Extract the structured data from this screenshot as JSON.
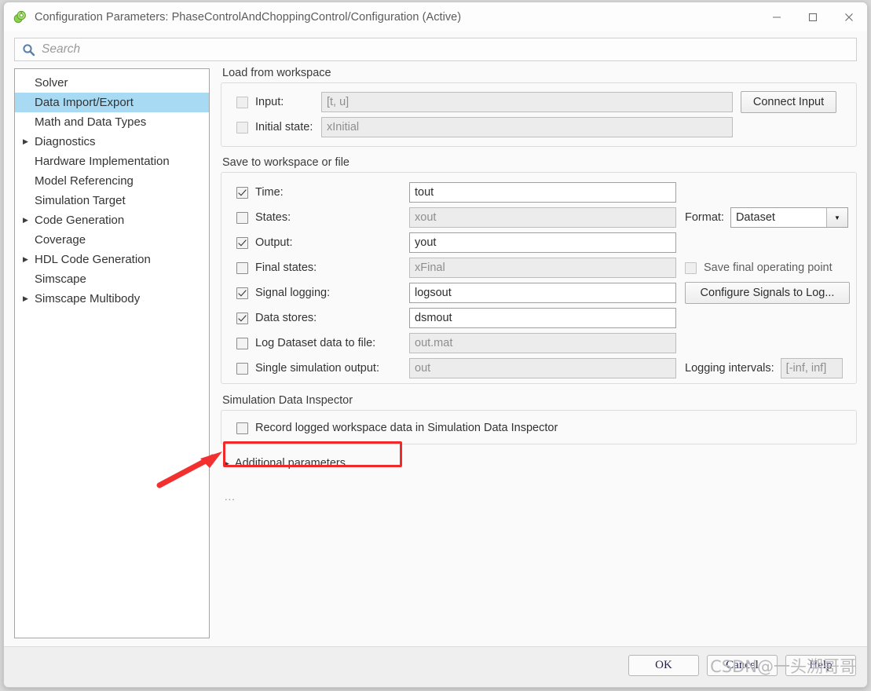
{
  "window": {
    "title": "Configuration Parameters: PhaseControlAndChoppingControl/Configuration (Active)",
    "app_icon": "simulink-config-icon",
    "minimize": "─",
    "maximize": "□",
    "close": "✕"
  },
  "search": {
    "placeholder": "Search",
    "icon": "search-icon"
  },
  "sidebar": {
    "items": [
      {
        "label": "Solver",
        "expandable": false,
        "selected": false
      },
      {
        "label": "Data Import/Export",
        "expandable": false,
        "selected": true
      },
      {
        "label": "Math and Data Types",
        "expandable": false,
        "selected": false
      },
      {
        "label": "Diagnostics",
        "expandable": true,
        "selected": false
      },
      {
        "label": "Hardware Implementation",
        "expandable": false,
        "selected": false
      },
      {
        "label": "Model Referencing",
        "expandable": false,
        "selected": false
      },
      {
        "label": "Simulation Target",
        "expandable": false,
        "selected": false
      },
      {
        "label": "Code Generation",
        "expandable": true,
        "selected": false
      },
      {
        "label": "Coverage",
        "expandable": false,
        "selected": false
      },
      {
        "label": "HDL Code Generation",
        "expandable": true,
        "selected": false
      },
      {
        "label": "Simscape",
        "expandable": false,
        "selected": false
      },
      {
        "label": "Simscape Multibody",
        "expandable": true,
        "selected": false
      }
    ],
    "expand_glyph": "▶"
  },
  "load_from_workspace": {
    "title": "Load from workspace",
    "input": {
      "label": "Input:",
      "value": "[t, u]",
      "checked": false,
      "enabled": false
    },
    "initial_state": {
      "label": "Initial state:",
      "value": "xInitial",
      "checked": false,
      "enabled": false
    },
    "connect_input_button": "Connect Input"
  },
  "save_to_workspace": {
    "title": "Save to workspace or file",
    "rows": [
      {
        "label": "Time:",
        "value": "tout",
        "checked": true,
        "enabled": true
      },
      {
        "label": "States:",
        "value": "xout",
        "checked": false,
        "enabled": false
      },
      {
        "label": "Output:",
        "value": "yout",
        "checked": true,
        "enabled": true
      },
      {
        "label": "Final states:",
        "value": "xFinal",
        "checked": false,
        "enabled": false
      },
      {
        "label": "Signal logging:",
        "value": "logsout",
        "checked": true,
        "enabled": true
      },
      {
        "label": "Data stores:",
        "value": "dsmout",
        "checked": true,
        "enabled": true
      },
      {
        "label": "Log Dataset data to file:",
        "value": "out.mat",
        "checked": false,
        "enabled": false
      },
      {
        "label": "Single simulation output:",
        "value": "out",
        "checked": false,
        "enabled": false
      }
    ],
    "format": {
      "label": "Format:",
      "value": "Dataset",
      "arrow": "▼"
    },
    "save_final_operating_point": {
      "label": "Save final operating point",
      "checked": false,
      "enabled": false
    },
    "configure_signals_button": "Configure Signals to Log...",
    "logging_intervals": {
      "label": "Logging intervals:",
      "value": "[-inf, inf]",
      "enabled": false
    }
  },
  "simulation_data_inspector": {
    "title": "Simulation Data Inspector",
    "record_option": {
      "label": "Record logged workspace data in Simulation Data Inspector",
      "checked": false
    }
  },
  "additional_parameters": {
    "label": "Additional parameters",
    "expand_glyph": "▶",
    "ellipsis": "..."
  },
  "footer": {
    "ok": "OK",
    "cancel": "Cancel",
    "help": "Help"
  },
  "watermark": {
    "text": "CSDN@一头溯哥哥"
  },
  "annotation": {
    "highlight_target": "Single simulation output:",
    "arrow_color": "#f02a2a",
    "box_color": "#f02a2a"
  }
}
